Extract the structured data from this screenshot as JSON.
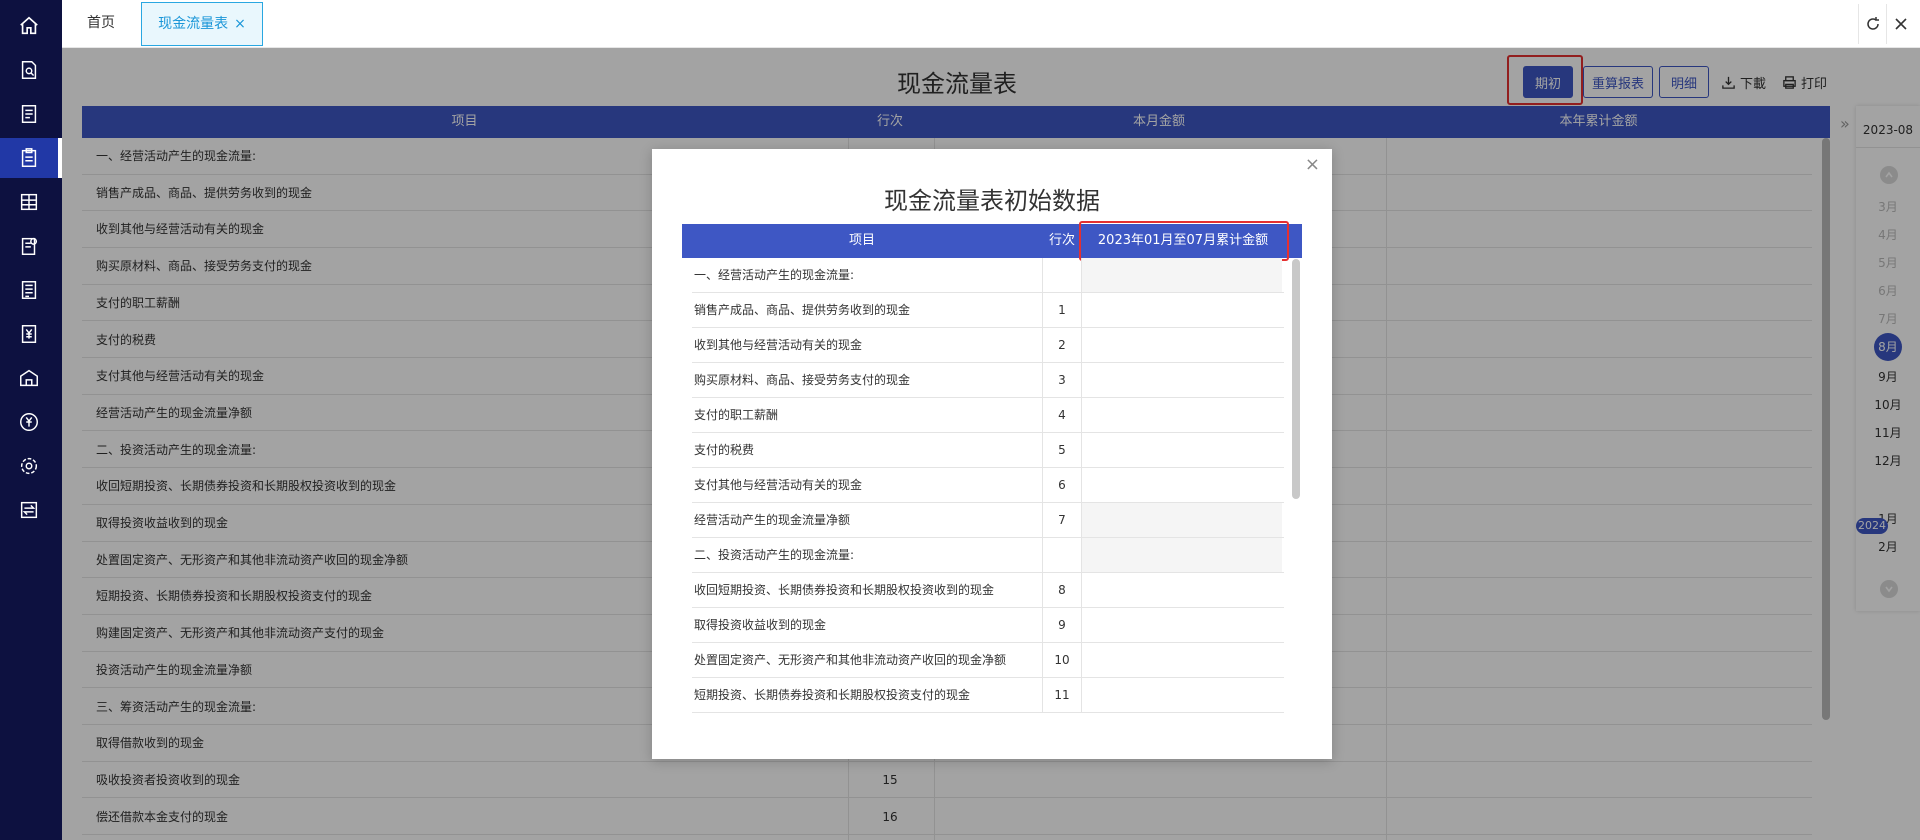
{
  "tabs": {
    "home": "首页",
    "active": "现金流量表",
    "close": "×"
  },
  "page": {
    "title": "现金流量表"
  },
  "toolbar": {
    "initial": "期初",
    "recalc": "重算报表",
    "detail": "明细",
    "download": "下載",
    "print": "打印"
  },
  "table": {
    "headers": [
      "项目",
      "行次",
      "本月金额",
      "本年累计金额"
    ],
    "rows": [
      {
        "item": "一、经营活动产生的现金流量:",
        "line": ""
      },
      {
        "item": "销售产成品、商品、提供劳务收到的现金",
        "line": ""
      },
      {
        "item": "收到其他与经营活动有关的现金",
        "line": ""
      },
      {
        "item": "购买原材料、商品、接受劳务支付的现金",
        "line": ""
      },
      {
        "item": "支付的职工薪酬",
        "line": ""
      },
      {
        "item": "支付的税费",
        "line": ""
      },
      {
        "item": "支付其他与经营活动有关的现金",
        "line": ""
      },
      {
        "item": "经营活动产生的现金流量净额",
        "line": ""
      },
      {
        "item": "二、投资活动产生的现金流量:",
        "line": ""
      },
      {
        "item": "收回短期投资、长期债券投资和长期股权投资收到的现金",
        "line": ""
      },
      {
        "item": "取得投资收益收到的现金",
        "line": ""
      },
      {
        "item": "处置固定资产、无形资产和其他非流动资产收回的现金净额",
        "line": ""
      },
      {
        "item": "短期投资、长期债券投资和长期股权投资支付的现金",
        "line": ""
      },
      {
        "item": "购建固定资产、无形资产和其他非流动资产支付的现金",
        "line": ""
      },
      {
        "item": "投资活动产生的现金流量净额",
        "line": ""
      },
      {
        "item": "三、筹资活动产生的现金流量:",
        "line": ""
      },
      {
        "item": "取得借款收到的现金",
        "line": ""
      },
      {
        "item": "吸收投资者投资收到的现金",
        "line": "15"
      },
      {
        "item": "偿还借款本金支付的现金",
        "line": "16"
      }
    ]
  },
  "period": {
    "current": "2023-08",
    "months": [
      "3月",
      "4月",
      "5月",
      "6月",
      "7月",
      "8月",
      "9月",
      "10月",
      "11月",
      "12月",
      "1月",
      "2月"
    ],
    "selected": "8月",
    "year_badge": "2024"
  },
  "modal": {
    "title": "现金流量表初始数据",
    "close": "×",
    "headers": [
      "项目",
      "行次",
      "2023年01月至07月累计金额"
    ],
    "rows": [
      {
        "item": "一、经营活动产生的现金流量:",
        "line": ""
      },
      {
        "item": "销售产成品、商品、提供劳务收到的现金",
        "line": "1"
      },
      {
        "item": "收到其他与经营活动有关的现金",
        "line": "2"
      },
      {
        "item": "购买原材料、商品、接受劳务支付的现金",
        "line": "3"
      },
      {
        "item": "支付的职工薪酬",
        "line": "4"
      },
      {
        "item": "支付的税费",
        "line": "5"
      },
      {
        "item": "支付其他与经营活动有关的现金",
        "line": "6"
      },
      {
        "item": "经营活动产生的现金流量净额",
        "line": "7"
      },
      {
        "item": "二、投资活动产生的现金流量:",
        "line": ""
      },
      {
        "item": "收回短期投资、长期债券投资和长期股权投资收到的现金",
        "line": "8"
      },
      {
        "item": "取得投资收益收到的现金",
        "line": "9"
      },
      {
        "item": "处置固定资产、无形资产和其他非流动资产收回的现金净额",
        "line": "10"
      },
      {
        "item": "短期投资、长期债券投资和长期股权投资支付的现金",
        "line": "11"
      }
    ]
  }
}
